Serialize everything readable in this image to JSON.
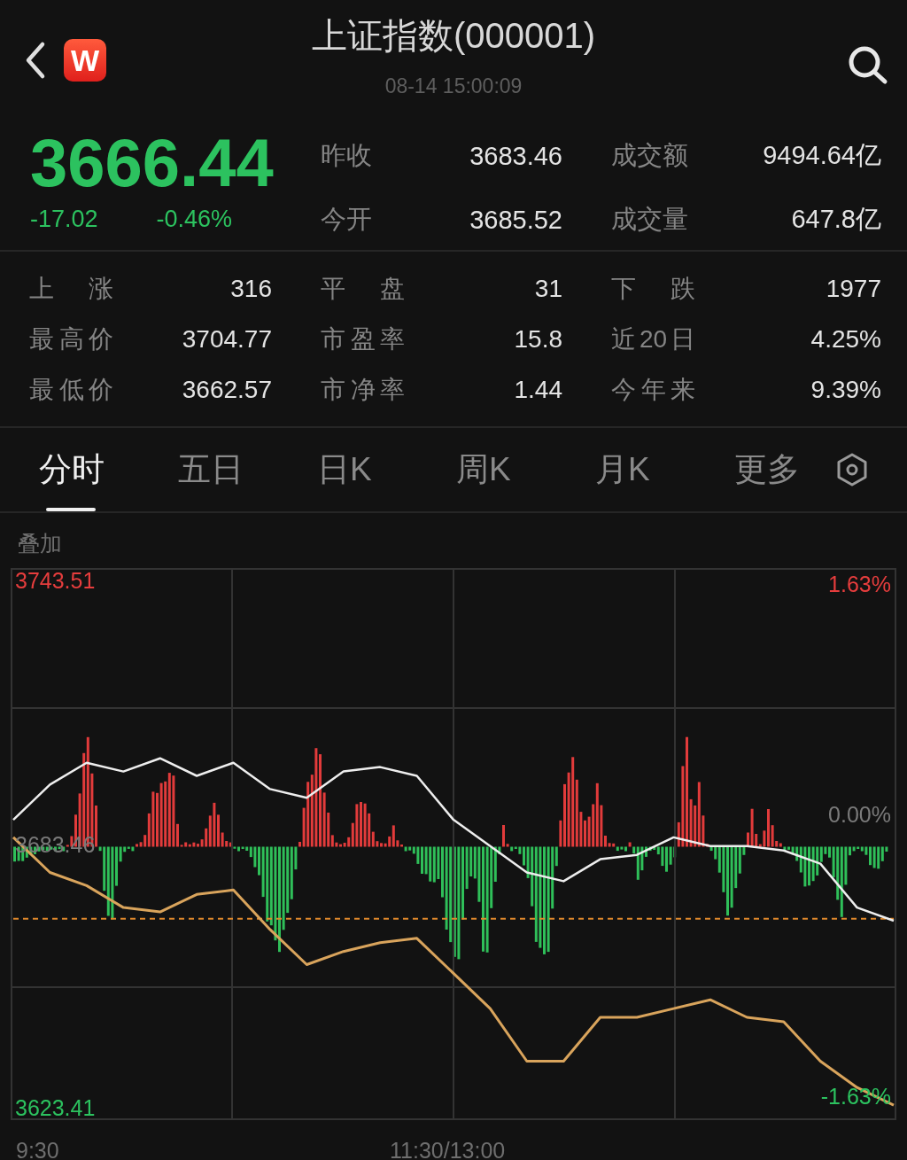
{
  "header": {
    "logo_text": "W",
    "title": "上证指数(000001)",
    "timestamp": "08-14 15:00:09"
  },
  "quote": {
    "price": "3666.44",
    "change": "-17.02",
    "change_percent": "-0.46%",
    "fields": [
      {
        "label": "昨收",
        "value": "3683.46"
      },
      {
        "label": "成交额",
        "value": "9494.64亿"
      },
      {
        "label": "今开",
        "value": "3685.52"
      },
      {
        "label": "成交量",
        "value": "647.8亿"
      }
    ]
  },
  "stats": [
    {
      "cells": [
        {
          "label": "上 涨",
          "value": "316"
        },
        {
          "label": "平 盘",
          "value": "31"
        },
        {
          "label": "下 跌",
          "value": "1977"
        }
      ]
    },
    {
      "cells": [
        {
          "label": "最高价",
          "value": "3704.77"
        },
        {
          "label": "市盈率",
          "value": "15.8"
        },
        {
          "label": "近20日",
          "value": "4.25%"
        }
      ]
    },
    {
      "cells": [
        {
          "label": "最低价",
          "value": "3662.57"
        },
        {
          "label": "市净率",
          "value": "1.44"
        },
        {
          "label": "今年来",
          "value": "9.39%"
        }
      ]
    }
  ],
  "tabs": [
    {
      "label": "分时",
      "selected": true
    },
    {
      "label": "五日",
      "selected": false
    },
    {
      "label": "日K",
      "selected": false
    },
    {
      "label": "周K",
      "selected": false
    },
    {
      "label": "月K",
      "selected": false
    },
    {
      "label": "更多",
      "selected": false
    }
  ],
  "chart": {
    "overlay_label": "叠加",
    "pct_high": "1.63%",
    "pct_mid": "0.00%",
    "pct_low": "-1.63%",
    "time_start": "9:30",
    "time_mid": "11:30/13:00",
    "chart_data": {
      "type": "line",
      "categories": [
        null,
        null,
        null,
        null,
        null,
        null,
        null,
        null,
        null,
        null,
        null,
        null,
        null,
        null,
        null,
        null,
        null,
        null,
        null,
        null,
        null,
        null,
        null,
        null,
        null
      ],
      "series": [
        {
          "color": "#eeeeee",
          "values": [
            3689,
            3697,
            3702,
            3700,
            3703,
            3699,
            3702,
            3696,
            3694,
            3700,
            3701,
            3699,
            3689,
            3683,
            3677,
            3675,
            3680,
            3681,
            3685,
            3683,
            3683,
            3682,
            3679,
            3669,
            3666
          ]
        },
        {
          "color": "#d9a45c",
          "values": [
            3685,
            3677,
            3674,
            3669,
            3668,
            3672,
            3673,
            3664,
            3656,
            3659,
            3661,
            3662,
            3654,
            3646,
            3634,
            3634,
            3644,
            3644,
            3646,
            3648,
            3644,
            3643,
            3634,
            3628,
            3624
          ]
        }
      ],
      "ylim": [
        3620.58,
        3746.34
      ],
      "grid": true,
      "ref_lines": [
        {
          "axis": "y",
          "value": 3666.44,
          "color": "#e0892c"
        }
      ],
      "yticks": [
        {
          "value": 3743.51,
          "label": "3743.51"
        },
        {
          "value": 3683.46,
          "label": "3683.46"
        },
        {
          "value": 3623.41,
          "label": "3623.41"
        }
      ]
    }
  }
}
